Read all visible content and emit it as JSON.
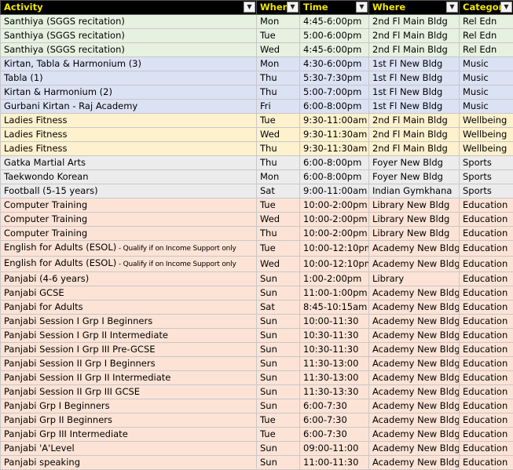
{
  "columns": [
    "Activity",
    "When",
    "Time",
    "Where",
    "Category"
  ],
  "rows": [
    {
      "group": "rel",
      "activity": "Santhiya (SGGS recitation)",
      "note": "",
      "when": "Mon",
      "time": "4:45-6:00pm",
      "where": "2nd Fl Main Bldg",
      "category": "Rel Edn"
    },
    {
      "group": "rel",
      "activity": "Santhiya (SGGS recitation)",
      "note": "",
      "when": "Tue",
      "time": "5:00-6:00pm",
      "where": "2nd Fl Main Bldg",
      "category": "Rel Edn"
    },
    {
      "group": "rel",
      "activity": "Santhiya (SGGS recitation)",
      "note": "",
      "when": "Wed",
      "time": "4:45-6:00pm",
      "where": "2nd Fl Main Bldg",
      "category": "Rel Edn"
    },
    {
      "group": "music",
      "activity": "Kirtan, Tabla & Harmonium (3)",
      "note": "",
      "when": "Mon",
      "time": "4:30-6:00pm",
      "where": "1st Fl New Bldg",
      "category": "Music"
    },
    {
      "group": "music",
      "activity": "Tabla (1)",
      "note": "",
      "when": "Thu",
      "time": "5:30-7:30pm",
      "where": "1st Fl New Bldg",
      "category": "Music"
    },
    {
      "group": "music",
      "activity": "Kirtan & Harmonium (2)",
      "note": "",
      "when": "Thu",
      "time": "5:00-7:00pm",
      "where": "1st Fl New Bldg",
      "category": "Music"
    },
    {
      "group": "music",
      "activity": "Gurbani Kirtan - Raj Academy",
      "note": "",
      "when": "Fri",
      "time": "6:00-8:00pm",
      "where": "1st Fl New Bldg",
      "category": "Music"
    },
    {
      "group": "well",
      "activity": "Ladies Fitness",
      "note": "",
      "when": "Tue",
      "time": "9:30-11:00am",
      "where": "2nd Fl Main Bldg",
      "category": "Wellbeing"
    },
    {
      "group": "well",
      "activity": "Ladies Fitness",
      "note": "",
      "when": "Wed",
      "time": "9:30-11:30am",
      "where": "2nd Fl Main Bldg",
      "category": "Wellbeing"
    },
    {
      "group": "well",
      "activity": "Ladies Fitness",
      "note": "",
      "when": "Thu",
      "time": "9:30-11:30am",
      "where": "2nd Fl Main Bldg",
      "category": "Wellbeing"
    },
    {
      "group": "sports",
      "activity": "Gatka Martial Arts",
      "note": "",
      "when": "Thu",
      "time": "6:00-8:00pm",
      "where": "Foyer New Bldg",
      "category": "Sports"
    },
    {
      "group": "sports",
      "activity": "Taekwondo Korean",
      "note": "",
      "when": "Mon",
      "time": "6:00-8:00pm",
      "where": "Foyer New Bldg",
      "category": "Sports"
    },
    {
      "group": "sports",
      "activity": "Football (5-15 years)",
      "note": "",
      "when": "Sat",
      "time": "9:00-11:00am",
      "where": "Indian Gymkhana",
      "category": "Sports"
    },
    {
      "group": "edu",
      "activity": "Computer Training",
      "note": "",
      "when": "Tue",
      "time": "10:00-2:00pm",
      "where": "Library New Bldg",
      "category": "Education"
    },
    {
      "group": "edu",
      "activity": "Computer Training",
      "note": "",
      "when": "Wed",
      "time": "10:00-2:00pm",
      "where": "Library New Bldg",
      "category": "Education"
    },
    {
      "group": "edu",
      "activity": "Computer Training",
      "note": "",
      "when": "Thu",
      "time": "10:00-2:00pm",
      "where": "Library New Bldg",
      "category": "Education"
    },
    {
      "group": "edu",
      "activity": "English for Adults (ESOL)",
      "note": " - Qualify if on Income Support only",
      "when": "Tue",
      "time": "10:00-12:10pm",
      "where": "Academy New Bldg",
      "category": "Education"
    },
    {
      "group": "edu",
      "activity": "English for Adults (ESOL)",
      "note": " - Qualify if on Income Support only",
      "when": "Wed",
      "time": "10:00-12:10pm",
      "where": "Academy New Bldg",
      "category": "Education"
    },
    {
      "group": "edu",
      "activity": "Panjabi (4-6 years)",
      "note": "",
      "when": "Sun",
      "time": "1:00-2:00pm",
      "where": "Library",
      "category": "Education"
    },
    {
      "group": "edu",
      "activity": "Panjabi GCSE",
      "note": "",
      "when": "Sun",
      "time": "11:00-1:00pm",
      "where": "Academy New Bldg",
      "category": "Education"
    },
    {
      "group": "edu",
      "activity": "Panjabi for Adults",
      "note": "",
      "when": "Sat",
      "time": "8:45-10:15am",
      "where": "Academy New Bldg",
      "category": "Education"
    },
    {
      "group": "edu",
      "activity": "Panjabi Session I Grp I Beginners",
      "note": "",
      "when": "Sun",
      "time": "10:00-11:30",
      "where": "Academy New Bldg",
      "category": "Education"
    },
    {
      "group": "edu",
      "activity": "Panjabi Session I Grp II Intermediate",
      "note": "",
      "when": "Sun",
      "time": "10:30-11:30",
      "where": "Academy New Bldg",
      "category": "Education"
    },
    {
      "group": "edu",
      "activity": "Panjabi Session I Grp III Pre-GCSE",
      "note": "",
      "when": "Sun",
      "time": "10:30-11:30",
      "where": "Academy New Bldg",
      "category": "Education"
    },
    {
      "group": "edu",
      "activity": "Panjabi Session II Grp I Beginners",
      "note": "",
      "when": "Sun",
      "time": "11:30-13:00",
      "where": "Academy New Bldg",
      "category": "Education"
    },
    {
      "group": "edu",
      "activity": "Panjabi Session II Grp II Intermediate",
      "note": "",
      "when": "Sun",
      "time": "11:30-13:00",
      "where": "Academy New Bldg",
      "category": "Education"
    },
    {
      "group": "edu",
      "activity": "Panjabi Session II Grp III GCSE",
      "note": "",
      "when": "Sun",
      "time": "11:30-13:30",
      "where": "Academy New Bldg",
      "category": "Education"
    },
    {
      "group": "edu",
      "activity": "Panjabi Grp I Beginners",
      "note": "",
      "when": "Sun",
      "time": "6:00-7:30",
      "where": "Academy New Bldg",
      "category": "Education"
    },
    {
      "group": "edu",
      "activity": "Panjabi Grp II Beginners",
      "note": "",
      "when": "Tue",
      "time": "6:00-7:30",
      "where": "Academy New Bldg",
      "category": "Education"
    },
    {
      "group": "edu",
      "activity": "Panjabi Grp III Intermediate",
      "note": "",
      "when": "Tue",
      "time": "6:00-7:30",
      "where": "Academy New Bldg",
      "category": "Education"
    },
    {
      "group": "edu",
      "activity": "Panjabi 'A'Level",
      "note": "",
      "when": "Sun",
      "time": "09:00-11:00",
      "where": "Academy New Bldg",
      "category": "Education"
    },
    {
      "group": "edu",
      "activity": "Panjabi speaking",
      "note": "",
      "when": "Sun",
      "time": "11:00-11:30",
      "where": "Academy New Bldg",
      "category": "Education"
    }
  ]
}
